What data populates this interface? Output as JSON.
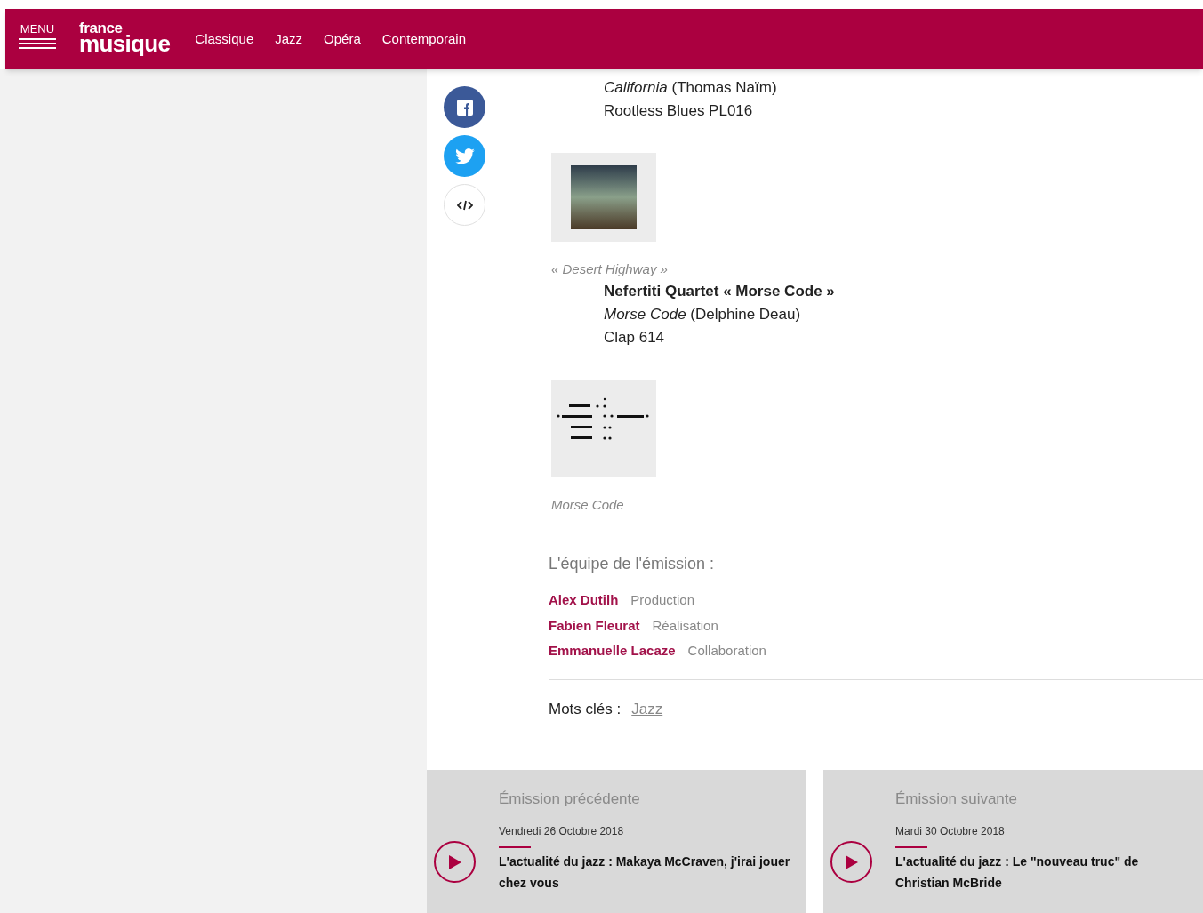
{
  "header": {
    "menu_label": "MENU",
    "logo_top": "france",
    "logo_bottom": "musique",
    "nav": [
      {
        "label": "Classique"
      },
      {
        "label": "Jazz"
      },
      {
        "label": "Opéra"
      },
      {
        "label": "Contemporain"
      }
    ]
  },
  "tracks": [
    {
      "album": "California",
      "performer": "(Thomas Naïm)",
      "label": "Rootless Blues PL016",
      "kind": "photo",
      "caption": "« Desert Highway »"
    },
    {
      "title": "Nefertiti Quartet « Morse Code »",
      "album": "Morse Code",
      "performer": "(Delphine Deau)",
      "label": "Clap 614",
      "kind": "morse",
      "caption": "Morse Code"
    }
  ],
  "team": {
    "title": "L'équipe de l'émission :",
    "members": [
      {
        "name": "Alex Dutilh",
        "role": "Production"
      },
      {
        "name": "Fabien Fleurat",
        "role": "Réalisation"
      },
      {
        "name": "Emmanuelle Lacaze",
        "role": "Collaboration"
      }
    ]
  },
  "keywords": {
    "label": "Mots clés :",
    "tags": [
      "Jazz"
    ]
  },
  "episodes": [
    {
      "heading": "Émission précédente",
      "date": "Vendredi 26 Octobre 2018",
      "title": "L'actualité du jazz : Makaya McCraven, j'irai jouer chez vous"
    },
    {
      "heading": "Émission suivante",
      "date": "Mardi 30 Octobre 2018",
      "title": "L'actualité du jazz : Le \"nouveau truc\" de Christian McBride"
    }
  ]
}
